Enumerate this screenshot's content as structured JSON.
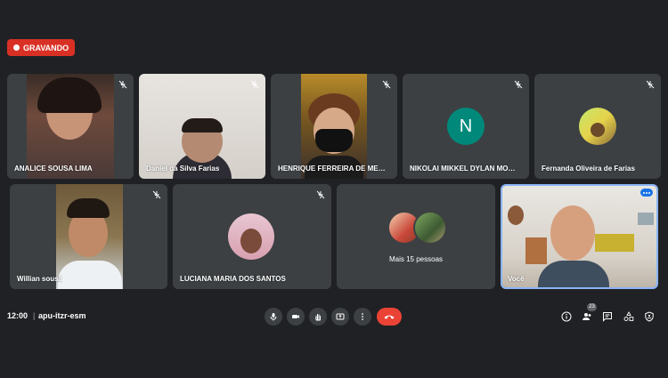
{
  "recording": {
    "label": "GRAVANDO",
    "color": "#d93025"
  },
  "participants": [
    {
      "name": "ANALICE SOUSA LIMA",
      "muted": true
    },
    {
      "name": "Daniel da Silva Farias",
      "muted": true
    },
    {
      "name": "HENRIQUE FERREIRA DE MESQUITA G...",
      "muted": true
    },
    {
      "name": "NIKOLAI MIKKEL DYLAN MONTEIRO S...",
      "muted": true,
      "initial": "N",
      "avatar_color": "#00897b"
    },
    {
      "name": "Fernanda Oliveira de Farias",
      "muted": true
    },
    {
      "name": "Willian sousa",
      "muted": true
    },
    {
      "name": "LUCIANA MARIA DOS SANTOS",
      "muted": true
    },
    {
      "name": "Você",
      "muted": false
    }
  ],
  "more_people": {
    "label": "Mais 15 pessoas"
  },
  "bottom_bar": {
    "time": "12:00",
    "separator": "|",
    "meeting_code": "apu-itzr-esm",
    "people_count": "23"
  },
  "icons": {
    "controls": [
      "mic-icon",
      "camera-icon",
      "raise-hand-icon",
      "present-icon",
      "more-options-icon",
      "hang-up-icon"
    ],
    "right": [
      "info-icon",
      "people-icon",
      "chat-icon",
      "activities-icon",
      "host-controls-icon"
    ]
  },
  "colors": {
    "background": "#202124",
    "tile": "#3c4043",
    "hangup": "#ea4335",
    "self_border": "#8ab4f8"
  }
}
